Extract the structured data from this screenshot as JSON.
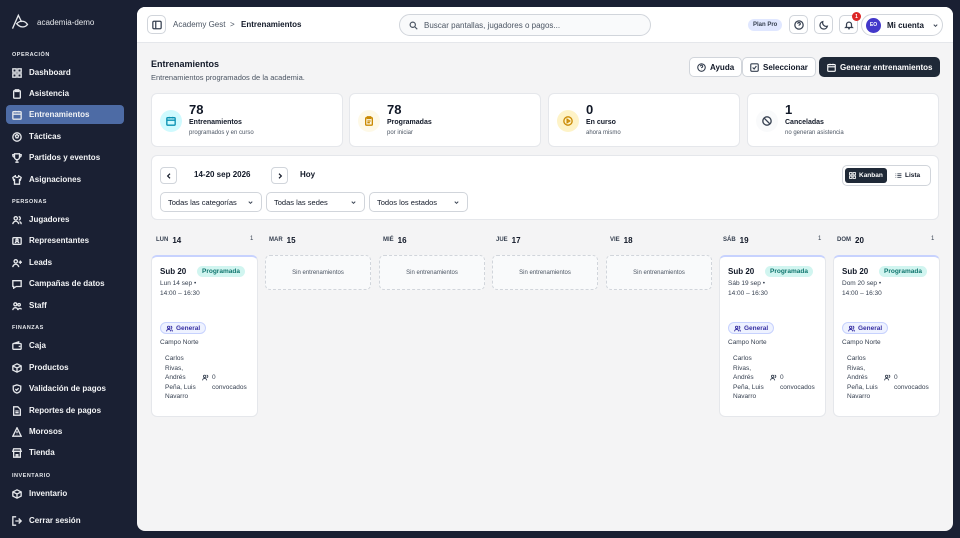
{
  "sidebar": {
    "brand": "academia-demo",
    "sections": {
      "operacion": "OPERACIÓN",
      "personas": "PERSONAS",
      "finanzas": "FINANZAS",
      "inventario": "INVENTARIO"
    },
    "items": {
      "dashboard": "Dashboard",
      "asistencia": "Asistencia",
      "entrenamientos": "Entrenamientos",
      "tacticas": "Tácticas",
      "partidos": "Partidos y eventos",
      "asignaciones": "Asignaciones",
      "jugadores": "Jugadores",
      "representantes": "Representantes",
      "leads": "Leads",
      "campanas": "Campañas de datos",
      "staff": "Staff",
      "caja": "Caja",
      "productos": "Productos",
      "validacion": "Validación de pagos",
      "reportes": "Reportes de pagos",
      "morosos": "Morosos",
      "tienda": "Tienda",
      "inventario": "Inventario",
      "logout": "Cerrar sesión"
    }
  },
  "topbar": {
    "breadcrumb_root": "Academy Gest",
    "breadcrumb_sep": ">",
    "breadcrumb_current": "Entrenamientos",
    "search_placeholder": "Buscar pantallas, jugadores o pagos...",
    "plan": "Plan Pro",
    "notifications": "1",
    "avatar_initials": "EO",
    "account": "Mi cuenta"
  },
  "header": {
    "title": "Entrenamientos",
    "subtitle": "Entrenamientos programados de la academia.",
    "help": "Ayuda",
    "select": "Seleccionar",
    "generate": "Generar entrenamientos"
  },
  "stats": [
    {
      "value": "78",
      "label": "Entrenamientos",
      "desc": "programados y en curso",
      "icon": "calendar-icon",
      "color": "#0891b2",
      "bg": "#cffafe"
    },
    {
      "value": "78",
      "label": "Programadas",
      "desc": "por iniciar",
      "icon": "clipboard-icon",
      "color": "#ca8a04",
      "bg": "#fef9e7"
    },
    {
      "value": "0",
      "label": "En curso",
      "desc": "ahora mismo",
      "icon": "play-icon",
      "color": "#ca8a04",
      "bg": "#fef3c7"
    },
    {
      "value": "1",
      "label": "Canceladas",
      "desc": "no generan asistencia",
      "icon": "ban-icon",
      "color": "#374151",
      "bg": "#f3f4f6"
    }
  ],
  "filters": {
    "range": "14-20 sep 2026",
    "today": "Hoy",
    "view_kanban": "Kanban",
    "view_list": "Lista",
    "category": "Todas las categorías",
    "venue": "Todas las sedes",
    "status": "Todos los estados"
  },
  "days": [
    {
      "name": "LUN",
      "num": "14",
      "count": "1"
    },
    {
      "name": "MAR",
      "num": "15",
      "count": ""
    },
    {
      "name": "MIÉ",
      "num": "16",
      "count": ""
    },
    {
      "name": "JUE",
      "num": "17",
      "count": ""
    },
    {
      "name": "VIE",
      "num": "18",
      "count": ""
    },
    {
      "name": "SÁB",
      "num": "19",
      "count": "1"
    },
    {
      "name": "DOM",
      "num": "20",
      "count": "1"
    }
  ],
  "empty_text": "Sin entrenamientos",
  "cards": [
    {
      "title": "Sub 20",
      "status": "Programada",
      "when": "Lun 14 sep • 14:00 – 16:30",
      "category": "General",
      "place": "Campo Norte",
      "staff": "Carlos Rivas, Andrés Peña, Luis Navarro",
      "convocados": "0 convocados"
    },
    {
      "title": "Sub 20",
      "status": "Programada",
      "when": "Sáb 19 sep • 14:00 – 16:30",
      "category": "General",
      "place": "Campo Norte",
      "staff": "Carlos Rivas, Andrés Peña, Luis Navarro",
      "convocados": "0 convocados"
    },
    {
      "title": "Sub 20",
      "status": "Programada",
      "when": "Dom 20 sep • 14:00 – 16:30",
      "category": "General",
      "place": "Campo Norte",
      "staff": "Carlos Rivas, Andrés Peña, Luis Navarro",
      "convocados": "0 convocados"
    }
  ]
}
